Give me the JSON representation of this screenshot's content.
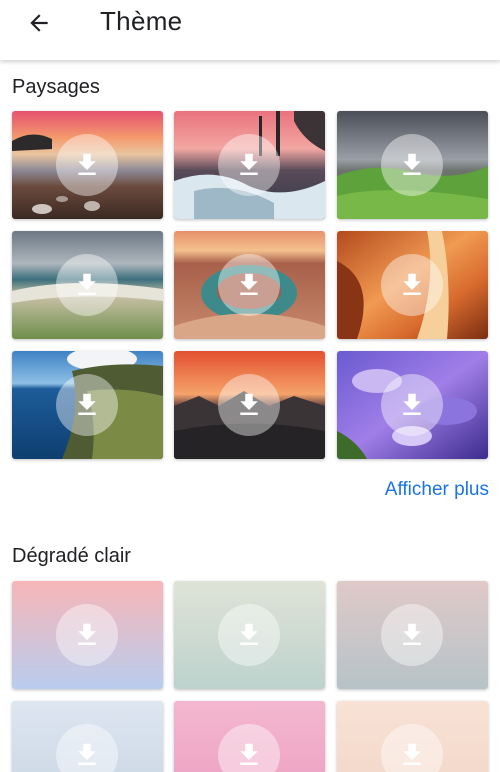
{
  "appbar": {
    "title": "Thème",
    "back_icon": "arrow-left-icon"
  },
  "sections": [
    {
      "title": "Paysages",
      "tiles": [
        {
          "name": "beach-sunset",
          "icon": "download-icon"
        },
        {
          "name": "waterfall-dusk",
          "icon": "download-icon"
        },
        {
          "name": "green-hills",
          "icon": "download-icon"
        },
        {
          "name": "shoreline",
          "icon": "download-icon"
        },
        {
          "name": "horseshoe-bend",
          "icon": "download-icon"
        },
        {
          "name": "antelope-canyon",
          "icon": "download-icon"
        },
        {
          "name": "coastal-cliffs",
          "icon": "download-icon"
        },
        {
          "name": "mountain-sunset",
          "icon": "download-icon"
        },
        {
          "name": "purple-stream",
          "icon": "download-icon"
        }
      ],
      "show_more": "Afficher plus"
    },
    {
      "title": "Dégradé clair",
      "tiles": [
        {
          "name": "pink-blue-gradient",
          "icon": "download-icon",
          "colors": [
            "#f7b6b8",
            "#b9cdee"
          ]
        },
        {
          "name": "grey-green-gradient",
          "icon": "download-icon",
          "colors": [
            "#dfe3d7",
            "#bdd2cd"
          ]
        },
        {
          "name": "mauve-grey-gradient",
          "icon": "download-icon",
          "colors": [
            "#e0c9c9",
            "#b6c3c7"
          ]
        },
        {
          "name": "light-blue-gradient",
          "icon": "download-icon",
          "colors": [
            "#dde6f1",
            "#c9d5e3"
          ]
        },
        {
          "name": "pink-gradient",
          "icon": "download-icon",
          "colors": [
            "#f3b7cf",
            "#ec9ec0"
          ]
        },
        {
          "name": "peach-gradient",
          "icon": "download-icon",
          "colors": [
            "#f8e2d5",
            "#f1d5c7"
          ]
        }
      ]
    }
  ],
  "colors": {
    "accent": "#1a73e8",
    "text": "#202124",
    "background": "#ffffff"
  }
}
